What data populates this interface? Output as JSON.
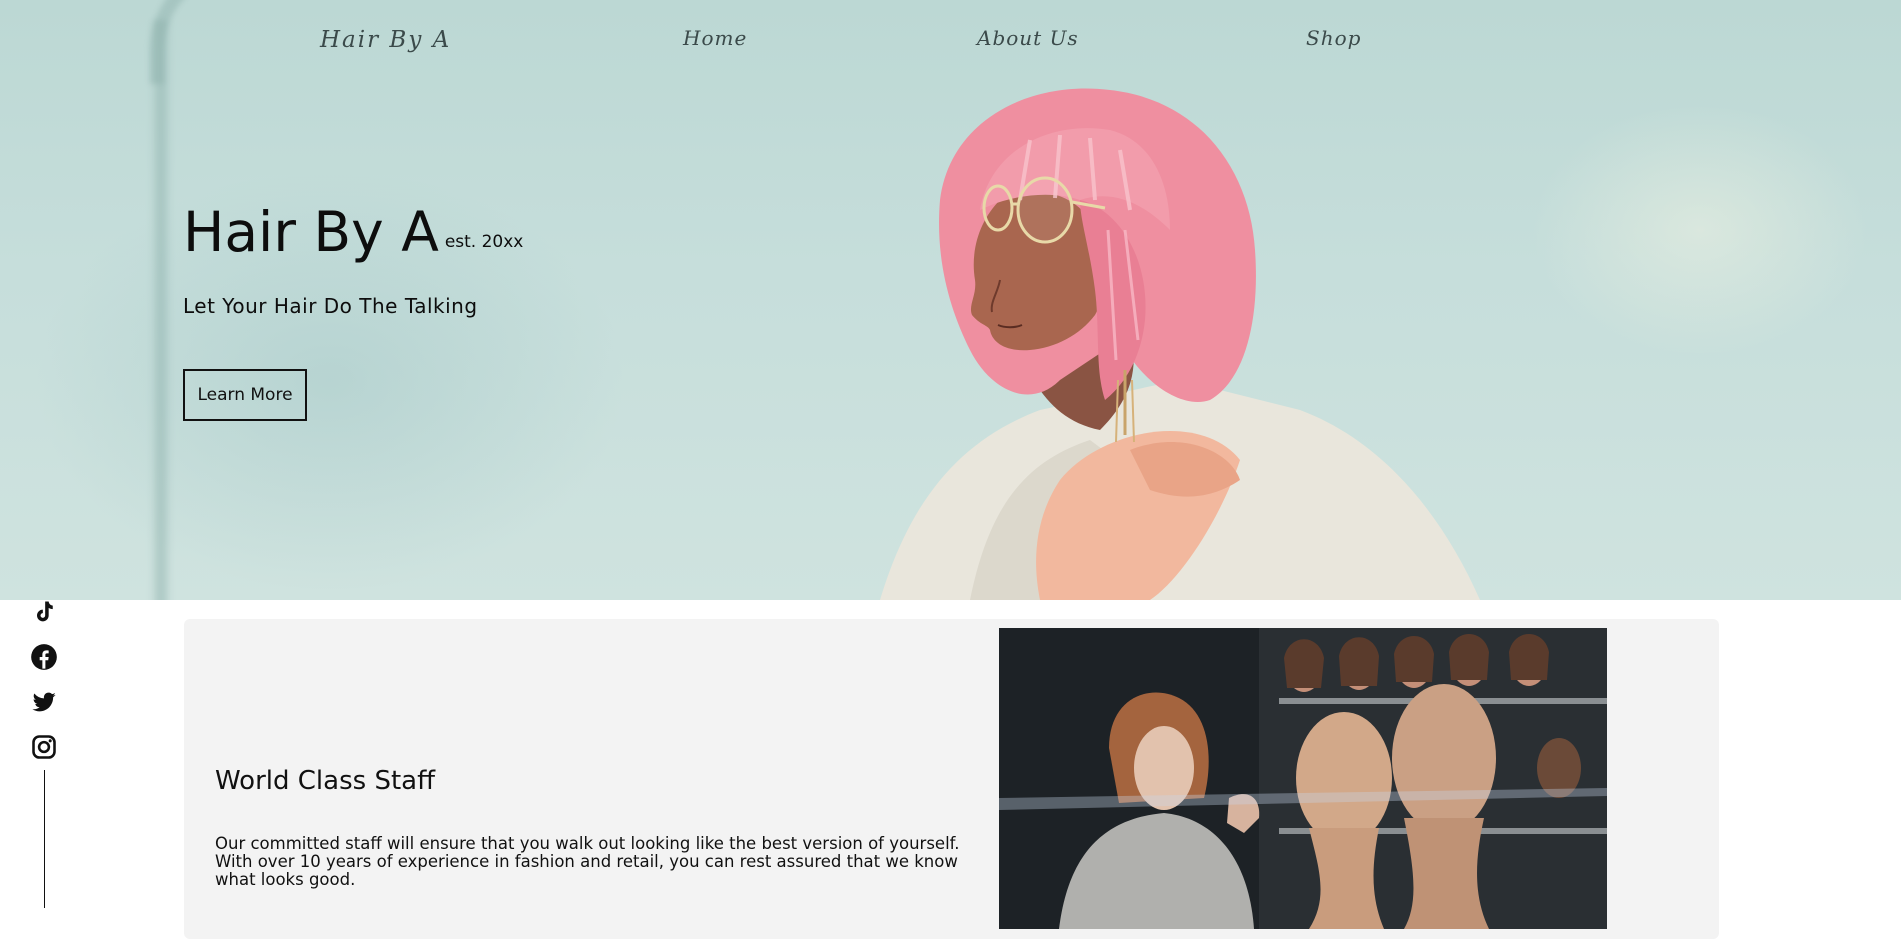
{
  "nav": {
    "brand": "Hair By A",
    "home": "Home",
    "about": "About Us",
    "shop": "Shop"
  },
  "hero": {
    "title": "Hair By A",
    "established": "est. 20xx",
    "tagline": "Let Your Hair Do The Talking",
    "cta_label": "Learn More",
    "image": "woman-pink-bob-wig-glasses-photo"
  },
  "social": {
    "icons": [
      "tiktok-icon",
      "facebook-icon",
      "twitter-icon",
      "instagram-icon"
    ]
  },
  "staff": {
    "title": "World Class Staff",
    "body": "Our committed staff will ensure that you walk out looking like the best version of yourself. With over 10 years of experience in fashion and retail, you can rest assured that we know what looks good.",
    "image": "wig-shop-mannequin-heads-photo"
  },
  "colors": {
    "hero_sky": "#c6dedb",
    "card_bg": "#f3f3f3",
    "hair_pink": "#ef8fa0",
    "text": "#111111"
  }
}
